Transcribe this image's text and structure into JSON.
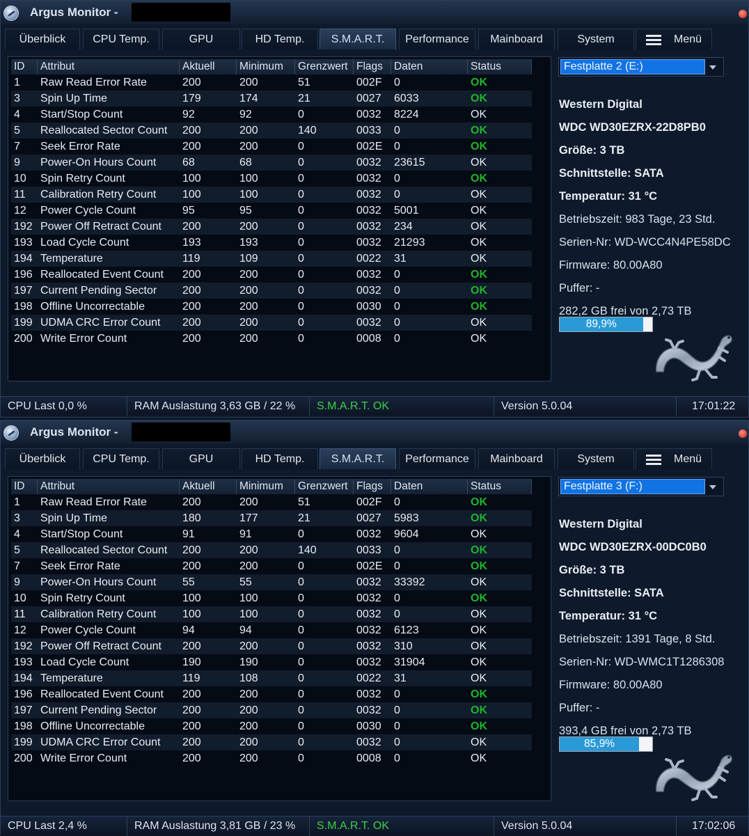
{
  "colors": {
    "ok_green": "#1eb52a",
    "selected_drive": "#1173e4",
    "usage_fill": "#2a9ad6",
    "smart_ok": "#3fcf4a"
  },
  "windows": [
    {
      "title": "Argus Monitor -",
      "tabs": [
        "Überblick",
        "CPU Temp.",
        "GPU",
        "HD Temp.",
        "S.M.A.R.T.",
        "Performance",
        "Mainboard",
        "System",
        "Menü"
      ],
      "active_tab": "S.M.A.R.T.",
      "columns": [
        "ID",
        "Attribut",
        "Aktuell",
        "Minimum",
        "Grenzwert",
        "Flags",
        "Daten",
        "Status"
      ],
      "rows": [
        {
          "id": "1",
          "attr": "Raw Read Error Rate",
          "cur": "200",
          "min": "200",
          "thr": "51",
          "flags": "002F",
          "data": "0",
          "status": "OK",
          "green": true
        },
        {
          "id": "3",
          "attr": "Spin Up Time",
          "cur": "179",
          "min": "174",
          "thr": "21",
          "flags": "0027",
          "data": "6033",
          "status": "OK",
          "green": true
        },
        {
          "id": "4",
          "attr": "Start/Stop Count",
          "cur": "92",
          "min": "92",
          "thr": "0",
          "flags": "0032",
          "data": "8224",
          "status": "OK",
          "green": false
        },
        {
          "id": "5",
          "attr": "Reallocated Sector Count",
          "cur": "200",
          "min": "200",
          "thr": "140",
          "flags": "0033",
          "data": "0",
          "status": "OK",
          "green": true
        },
        {
          "id": "7",
          "attr": "Seek Error Rate",
          "cur": "200",
          "min": "200",
          "thr": "0",
          "flags": "002E",
          "data": "0",
          "status": "OK",
          "green": true
        },
        {
          "id": "9",
          "attr": "Power-On Hours Count",
          "cur": "68",
          "min": "68",
          "thr": "0",
          "flags": "0032",
          "data": "23615",
          "status": "OK",
          "green": false
        },
        {
          "id": "10",
          "attr": "Spin Retry Count",
          "cur": "100",
          "min": "100",
          "thr": "0",
          "flags": "0032",
          "data": "0",
          "status": "OK",
          "green": true
        },
        {
          "id": "11",
          "attr": "Calibration Retry Count",
          "cur": "100",
          "min": "100",
          "thr": "0",
          "flags": "0032",
          "data": "0",
          "status": "OK",
          "green": false
        },
        {
          "id": "12",
          "attr": "Power Cycle Count",
          "cur": "95",
          "min": "95",
          "thr": "0",
          "flags": "0032",
          "data": "5001",
          "status": "OK",
          "green": false
        },
        {
          "id": "192",
          "attr": "Power Off Retract Count",
          "cur": "200",
          "min": "200",
          "thr": "0",
          "flags": "0032",
          "data": "234",
          "status": "OK",
          "green": false
        },
        {
          "id": "193",
          "attr": "Load Cycle Count",
          "cur": "193",
          "min": "193",
          "thr": "0",
          "flags": "0032",
          "data": "21293",
          "status": "OK",
          "green": false
        },
        {
          "id": "194",
          "attr": "Temperature",
          "cur": "119",
          "min": "109",
          "thr": "0",
          "flags": "0022",
          "data": "31",
          "status": "OK",
          "green": false
        },
        {
          "id": "196",
          "attr": "Reallocated Event Count",
          "cur": "200",
          "min": "200",
          "thr": "0",
          "flags": "0032",
          "data": "0",
          "status": "OK",
          "green": true
        },
        {
          "id": "197",
          "attr": "Current Pending Sector",
          "cur": "200",
          "min": "200",
          "thr": "0",
          "flags": "0032",
          "data": "0",
          "status": "OK",
          "green": true
        },
        {
          "id": "198",
          "attr": "Offline Uncorrectable",
          "cur": "200",
          "min": "200",
          "thr": "0",
          "flags": "0030",
          "data": "0",
          "status": "OK",
          "green": true
        },
        {
          "id": "199",
          "attr": "UDMA CRC Error Count",
          "cur": "200",
          "min": "200",
          "thr": "0",
          "flags": "0032",
          "data": "0",
          "status": "OK",
          "green": false
        },
        {
          "id": "200",
          "attr": "Write Error Count",
          "cur": "200",
          "min": "200",
          "thr": "0",
          "flags": "0008",
          "data": "0",
          "status": "OK",
          "green": false
        }
      ],
      "info": {
        "drive": "Festplatte 2 (E:)",
        "vendor": "Western Digital",
        "model": "WDC WD30EZRX-22D8PB0",
        "size": "Größe: 3 TB",
        "interface": "Schnittstelle: SATA",
        "temperature": "Temperatur: 31 °C",
        "uptime": "Betriebszeit: 983 Tage, 23 Std.",
        "serial": "Serien-Nr: WD-WCC4N4PE58DC",
        "firmware": "Firmware: 80.00A80",
        "buffer": "Puffer: -",
        "free": "282,2 GB frei von 2,73 TB",
        "usage_text": "89,9%",
        "usage_fraction": 0.899
      },
      "status": {
        "cpu": "CPU Last 0,0 %",
        "ram": "RAM Auslastung 3,63 GB / 22 %",
        "smart": "S.M.A.R.T. OK",
        "version": "Version 5.0.04",
        "time": "17:01:22"
      }
    },
    {
      "title": "Argus Monitor -",
      "tabs": [
        "Überblick",
        "CPU Temp.",
        "GPU",
        "HD Temp.",
        "S.M.A.R.T.",
        "Performance",
        "Mainboard",
        "System",
        "Menü"
      ],
      "active_tab": "S.M.A.R.T.",
      "columns": [
        "ID",
        "Attribut",
        "Aktuell",
        "Minimum",
        "Grenzwert",
        "Flags",
        "Daten",
        "Status"
      ],
      "rows": [
        {
          "id": "1",
          "attr": "Raw Read Error Rate",
          "cur": "200",
          "min": "200",
          "thr": "51",
          "flags": "002F",
          "data": "0",
          "status": "OK",
          "green": true
        },
        {
          "id": "3",
          "attr": "Spin Up Time",
          "cur": "180",
          "min": "177",
          "thr": "21",
          "flags": "0027",
          "data": "5983",
          "status": "OK",
          "green": true
        },
        {
          "id": "4",
          "attr": "Start/Stop Count",
          "cur": "91",
          "min": "91",
          "thr": "0",
          "flags": "0032",
          "data": "9604",
          "status": "OK",
          "green": false
        },
        {
          "id": "5",
          "attr": "Reallocated Sector Count",
          "cur": "200",
          "min": "200",
          "thr": "140",
          "flags": "0033",
          "data": "0",
          "status": "OK",
          "green": true
        },
        {
          "id": "7",
          "attr": "Seek Error Rate",
          "cur": "200",
          "min": "200",
          "thr": "0",
          "flags": "002E",
          "data": "0",
          "status": "OK",
          "green": true
        },
        {
          "id": "9",
          "attr": "Power-On Hours Count",
          "cur": "55",
          "min": "55",
          "thr": "0",
          "flags": "0032",
          "data": "33392",
          "status": "OK",
          "green": false
        },
        {
          "id": "10",
          "attr": "Spin Retry Count",
          "cur": "100",
          "min": "100",
          "thr": "0",
          "flags": "0032",
          "data": "0",
          "status": "OK",
          "green": true
        },
        {
          "id": "11",
          "attr": "Calibration Retry Count",
          "cur": "100",
          "min": "100",
          "thr": "0",
          "flags": "0032",
          "data": "0",
          "status": "OK",
          "green": false
        },
        {
          "id": "12",
          "attr": "Power Cycle Count",
          "cur": "94",
          "min": "94",
          "thr": "0",
          "flags": "0032",
          "data": "6123",
          "status": "OK",
          "green": false
        },
        {
          "id": "192",
          "attr": "Power Off Retract Count",
          "cur": "200",
          "min": "200",
          "thr": "0",
          "flags": "0032",
          "data": "310",
          "status": "OK",
          "green": false
        },
        {
          "id": "193",
          "attr": "Load Cycle Count",
          "cur": "190",
          "min": "190",
          "thr": "0",
          "flags": "0032",
          "data": "31904",
          "status": "OK",
          "green": false
        },
        {
          "id": "194",
          "attr": "Temperature",
          "cur": "119",
          "min": "108",
          "thr": "0",
          "flags": "0022",
          "data": "31",
          "status": "OK",
          "green": false
        },
        {
          "id": "196",
          "attr": "Reallocated Event Count",
          "cur": "200",
          "min": "200",
          "thr": "0",
          "flags": "0032",
          "data": "0",
          "status": "OK",
          "green": true
        },
        {
          "id": "197",
          "attr": "Current Pending Sector",
          "cur": "200",
          "min": "200",
          "thr": "0",
          "flags": "0032",
          "data": "0",
          "status": "OK",
          "green": true
        },
        {
          "id": "198",
          "attr": "Offline Uncorrectable",
          "cur": "200",
          "min": "200",
          "thr": "0",
          "flags": "0030",
          "data": "0",
          "status": "OK",
          "green": true
        },
        {
          "id": "199",
          "attr": "UDMA CRC Error Count",
          "cur": "200",
          "min": "200",
          "thr": "0",
          "flags": "0032",
          "data": "0",
          "status": "OK",
          "green": false
        },
        {
          "id": "200",
          "attr": "Write Error Count",
          "cur": "200",
          "min": "200",
          "thr": "0",
          "flags": "0008",
          "data": "0",
          "status": "OK",
          "green": false
        }
      ],
      "info": {
        "drive": "Festplatte 3 (F:)",
        "vendor": "Western Digital",
        "model": "WDC WD30EZRX-00DC0B0",
        "size": "Größe: 3 TB",
        "interface": "Schnittstelle: SATA",
        "temperature": "Temperatur: 31 °C",
        "uptime": "Betriebszeit: 1391 Tage, 8 Std.",
        "serial": "Serien-Nr: WD-WMC1T1286308",
        "firmware": "Firmware: 80.00A80",
        "buffer": "Puffer: -",
        "free": "393,4 GB frei von 2,73 TB",
        "usage_text": "85,9%",
        "usage_fraction": 0.859
      },
      "status": {
        "cpu": "CPU Last 2,4 %",
        "ram": "RAM Auslastung 3,81 GB / 23 %",
        "smart": "S.M.A.R.T. OK",
        "version": "Version 5.0.04",
        "time": "17:02:06"
      }
    }
  ]
}
